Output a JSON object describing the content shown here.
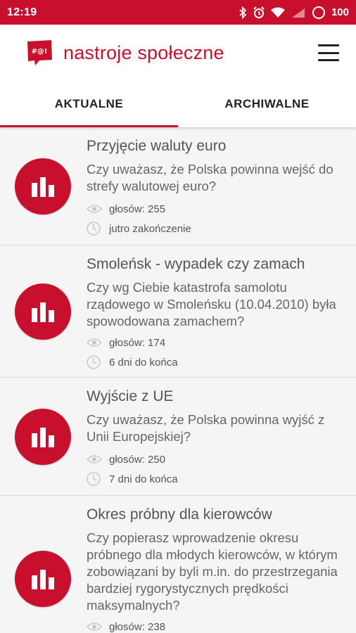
{
  "status_bar": {
    "time": "12:19",
    "battery": "100",
    "icons": [
      "bluetooth-icon",
      "alarm-icon",
      "wifi-icon",
      "signal-icon",
      "battery-icon"
    ]
  },
  "header": {
    "title": "nastroje społeczne",
    "logo_text": "#@!",
    "accent_color": "#c8102e"
  },
  "tabs": [
    {
      "label": "AKTUALNE",
      "active": true
    },
    {
      "label": "ARCHIWALNE",
      "active": false
    }
  ],
  "polls": [
    {
      "title": "Przyjęcie waluty euro",
      "question": "Czy uważasz, że Polska powinna wejść do strefy walutowej euro?",
      "votes": "głosów: 255",
      "deadline": "jutro zakończenie"
    },
    {
      "title": "Smoleńsk - wypadek czy zamach",
      "question": "Czy wg Ciebie katastrofa samolotu rządowego w Smoleńsku (10.04.2010) była spowodowana zamachem?",
      "votes": "głosów: 174",
      "deadline": "6 dni do końca"
    },
    {
      "title": "Wyjście z UE",
      "question": "Czy uważasz, że Polska powinna wyjść z Unii Europejskiej?",
      "votes": "głosów: 250",
      "deadline": "7 dni do końca"
    },
    {
      "title": "Okres próbny dla kierowców",
      "question": "Czy popierasz wprowadzenie okresu próbnego dla młodych kierowców, w którym zobowiązani by byli m.in. do przestrzegania bardziej rygorystycznych prędkości maksymalnych?",
      "votes": "głosów: 238",
      "deadline": ""
    }
  ]
}
